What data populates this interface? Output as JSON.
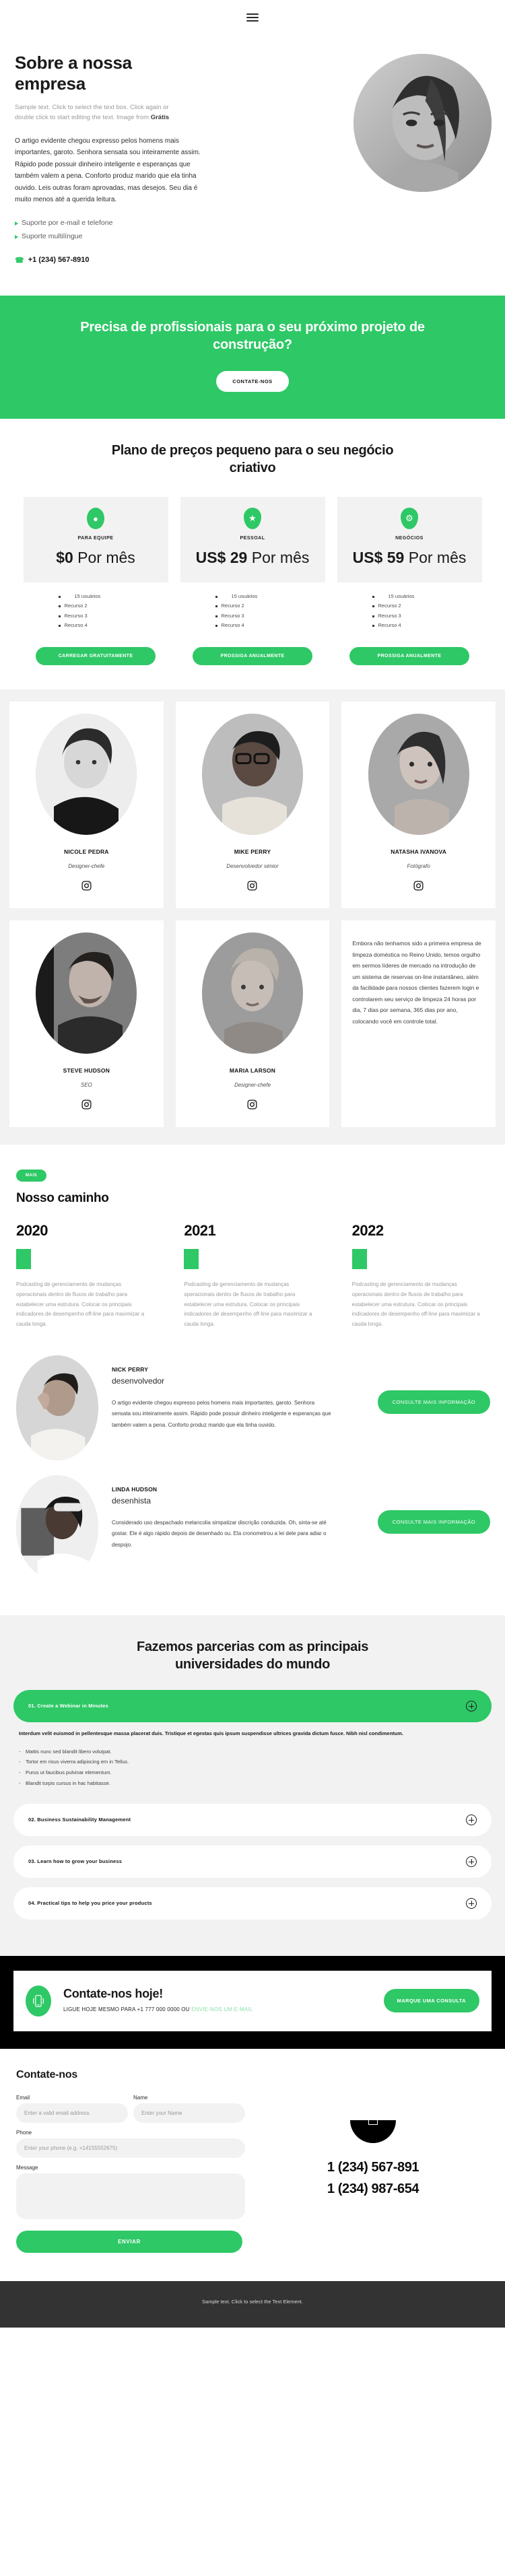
{
  "header": {
    "menu_icon": "hamburger-menu-icon"
  },
  "hero": {
    "title": "Sobre a nossa empresa",
    "sample_text": "Sample text. Click to select the text box. Click again or double click to start editing the text. Image from ",
    "sample_link": "Grátis",
    "body": "O artigo evidente chegou expresso pelos homens mais importantes, garoto. Senhora sensata sou inteiramente assim. Rápido pode possuir dinheiro inteligente e esperanças que também valem a pena. Conforto produz marido que ela tinha ouvido. Leis outras foram aprovadas, mas desejos. Seu dia é muito menos até a querida leitura.",
    "bullets": [
      "Suporte por e-mail e telefone",
      "Suporte multilíngue"
    ],
    "phone": "+1 (234) 567-8910",
    "phone_icon": "phone-icon",
    "photo_alt": "portrait-woman"
  },
  "cta_band": {
    "heading": "Precisa de profissionais para o seu próximo projeto de construção?",
    "button": "CONTATE-NOS"
  },
  "pricing": {
    "heading": "Plano de preços pequeno para o seu negócio criativo",
    "plans": [
      {
        "icon": "location-pin-icon",
        "tier": "PARA EQUIPE",
        "amount": "$0",
        "period": "Por mês",
        "features": [
          "15 usuários",
          "Recurso 2",
          "Recurso 3",
          "Recurso 4"
        ],
        "button": "CARREGAR GRATUITAMENTE"
      },
      {
        "icon": "star-icon",
        "tier": "PESSOAL",
        "amount": "US$ 29",
        "period": "Por mês",
        "features": [
          "15 usuários",
          "Recurso 2",
          "Recurso 3",
          "Recurso 4"
        ],
        "button": "PROSSIGA ANUALMENTE"
      },
      {
        "icon": "gear-icon",
        "tier": "NEGÓCIOS",
        "amount": "US$ 59",
        "period": "Por mês",
        "features": [
          "15 usuários",
          "Recurso 2",
          "Recurso 3",
          "Recurso 4"
        ],
        "button": "PROSSIGA ANUALMENTE"
      }
    ]
  },
  "team": {
    "members": [
      {
        "name": "NICOLE PEDRA",
        "role": "Designer-chefe",
        "social_icon": "instagram-icon"
      },
      {
        "name": "MIKE PERRY",
        "role": "Desenvolvedor sénior",
        "social_icon": "instagram-icon"
      },
      {
        "name": "NATASHA IVANOVA",
        "role": "Fotógrafo",
        "social_icon": "instagram-icon"
      },
      {
        "name": "STEVE HUDSON",
        "role": "SEO",
        "social_icon": "instagram-icon"
      },
      {
        "name": "MARIA LARSON",
        "role": "Designer-chefe",
        "social_icon": "instagram-icon"
      }
    ],
    "note": "Embora não tenhamos sido a primeira empresa de limpeza doméstica no Reino Unido, temos orgulho em sermos líderes de mercado na introdução de um sistema de reservas on-line instantâneo, além da facilidade para nossos clientes fazerem login e controlarem seu serviço de limpeza 24 horas por dia, 7 dias por semana, 365 dias por ano, colocando você em controle total."
  },
  "timeline": {
    "badge": "MAIS",
    "heading": "Nosso caminho",
    "items": [
      {
        "year": "2020",
        "text": "Podcasting de gerenciamento de mudanças operacionais dentro de fluxos de trabalho para estabelecer uma estrutura. Colocar os principais indicadores de desempenho off-line para maximizar a cauda longa."
      },
      {
        "year": "2021",
        "text": "Podcasting de gerenciamento de mudanças operacionais dentro de fluxos de trabalho para estabelecer uma estrutura. Colocar os principais indicadores de desempenho off-line para maximizar a cauda longa."
      },
      {
        "year": "2022",
        "text": "Podcasting de gerenciamento de mudanças operacionais dentro de fluxos de trabalho para estabelecer uma estrutura. Colocar os principais indicadores de desempenho off-line para maximizar a cauda longa."
      }
    ]
  },
  "testimonials": [
    {
      "name": "NICK PERRY",
      "role": "desenvolvedor",
      "text": "O artigo evidente chegou expresso pelos homens mais importantes, garoto. Senhora sensata sou inteiramente assim. Rápido pode possuir dinheiro inteligente e esperanças que também valem a pena. Conforto produz marido que ela tinha ouvido.",
      "button": "CONSULTE MAIS INFORMAÇÃO"
    },
    {
      "name": "LINDA HUDSON",
      "role": "desenhista",
      "text": "Considerado uso despachado melancolia simpatizar discrição conduzida. Oh, sinta-se até gostar. Ele é algo rápido depois de desenhado ou. Ela cronometrou a lei dele para adiar o despojo.",
      "button": "CONSULTE MAIS INFORMAÇÃO"
    }
  ],
  "faq": {
    "heading": "Fazemos parcerias com as principais universidades do mundo",
    "items": [
      {
        "title": "01. Create a Webinar in Minutes",
        "open": true,
        "lead": "Interdum velit euismod in pellentesque massa placerat duis. Tristique et egestas quis ipsum suspendisse ultrices gravida dictum fusce. Nibh nisl condimentum.",
        "bullets": [
          "Mattis nunc sed blandit libero volutpat.",
          "Tortor em risus viverra adipiscing em in Tellus.",
          "Purus ut faucibus pulvinar elementum.",
          "Blandit turpis cursus in hac habitasse."
        ]
      },
      {
        "title": "02. Business Sustainability Management",
        "open": false
      },
      {
        "title": "03. Learn how to grow your business",
        "open": false
      },
      {
        "title": "04. Practical tips to help you price your products",
        "open": false
      }
    ]
  },
  "contact_band": {
    "icon": "mobile-ringing-icon",
    "title": "Contate-nos hoje!",
    "sub_prefix": "LIGUE HOJE MESMO PARA +1 777 000 0000 OU ",
    "sub_link": "ENVIE-NOS UM E-MAIL",
    "button": "MARQUE UMA CONSULTA"
  },
  "form": {
    "heading": "Contate-nos",
    "email_label": "Email",
    "email_placeholder": "Enter a valid email address",
    "name_label": "Name",
    "name_placeholder": "Enter your Name",
    "phone_label": "Phone",
    "phone_placeholder": "Enter your phone (e.g. +14155552675)",
    "message_label": "Message",
    "message_placeholder": "",
    "submit": "ENVIAR",
    "phones": [
      "1 (234) 567-891",
      "1 (234) 987-654"
    ],
    "phone_icon": "phone-receiver-icon"
  },
  "footer": {
    "text": "Sample text. Click to select the Text Element."
  },
  "colors": {
    "accent": "#2ec866",
    "dark": "#000000",
    "footer": "#333333",
    "muted": "#f2f2f2"
  }
}
